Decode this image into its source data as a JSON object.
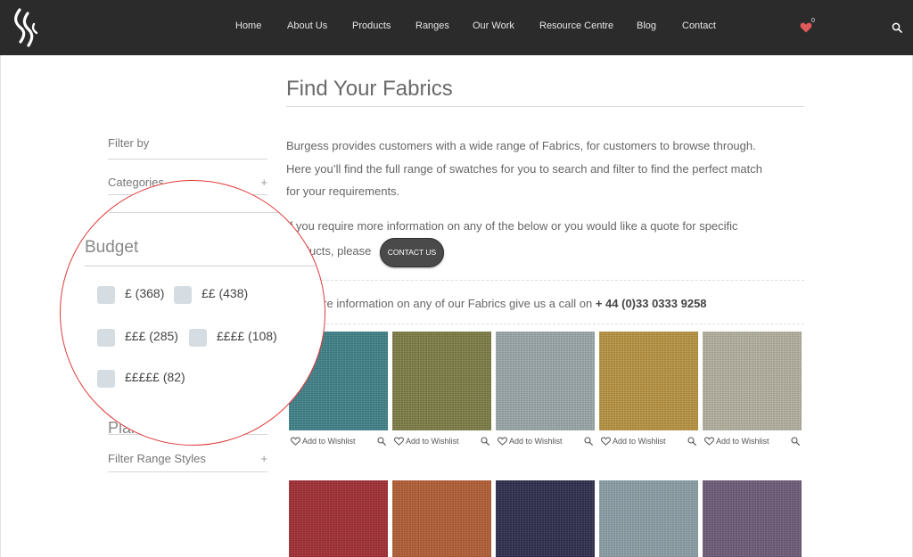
{
  "colors": {
    "header_bg": "#2b2b2b",
    "accent_heart": "#e05a5a",
    "lens_ring": "#e03a3a",
    "checkbox": "#d5dde3"
  },
  "nav": {
    "items": [
      {
        "label": "Home"
      },
      {
        "label": "About Us"
      },
      {
        "label": "Products"
      },
      {
        "label": "Ranges"
      },
      {
        "label": "Our Work"
      },
      {
        "label": "Resource Centre"
      },
      {
        "label": "Blog"
      },
      {
        "label": "Contact"
      }
    ],
    "wishlist_count": "0",
    "icons": {
      "logo": "brand-logo",
      "wishlist": "heart-icon",
      "search": "search-icon"
    }
  },
  "sidebar": {
    "filter_by": "Filter by",
    "categories": "Categories",
    "categories_toggle": "+",
    "plain_patterned": "Plain or Patterned",
    "range_styles": "Filter Range Styles",
    "range_styles_toggle": "+"
  },
  "budget": {
    "title": "Budget",
    "options": [
      {
        "label": "£ (368)",
        "checked": false
      },
      {
        "label": "££ (438)",
        "checked": false
      },
      {
        "label": "£££ (285)",
        "checked": false
      },
      {
        "label": "££££ (108)",
        "checked": false
      },
      {
        "label": "£££££ (82)",
        "checked": false
      }
    ]
  },
  "main": {
    "title": "Find Your Fabrics",
    "intro_lines": [
      "Burgess provides customers with a wide range of Fabrics, for customers to browse through.",
      "Here you’ll find the full range of swatches for you to search and filter to find the perfect match",
      "for your requirements."
    ],
    "quote_line_1": "If you require more information on any of the below or you would like a quote for specific",
    "quote_line_2": "products, please",
    "contact_button": "CONTACT US",
    "call_text": "For more information on any of our Fabrics give us a call on",
    "call_number": "+ 44 (0)33 0333 9258",
    "wishlist_label": "Add to Wishlist",
    "swatches": [
      {
        "color": "#3e8289"
      },
      {
        "color": "#7d7d46"
      },
      {
        "color": "#9aa7a9"
      },
      {
        "color": "#b89340"
      },
      {
        "color": "#b4b1a0"
      },
      {
        "color": "#a22d33"
      },
      {
        "color": "#b35e34"
      },
      {
        "color": "#2d2d4d"
      },
      {
        "color": "#8c9fa7"
      },
      {
        "color": "#6d5b78"
      }
    ]
  }
}
